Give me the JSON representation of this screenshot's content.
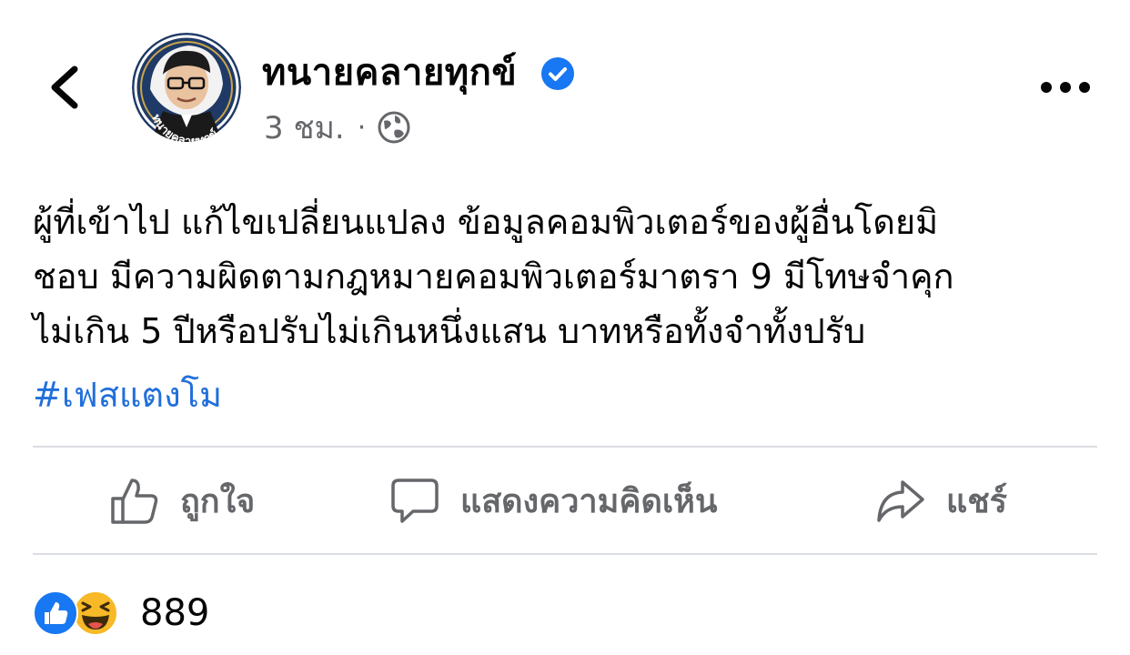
{
  "post": {
    "author": "ทนายคลายทุกข์",
    "avatar_text": "ทนายคลายทุกข์",
    "time": "3 ชม.",
    "separator": "·",
    "text_lines": [
      "ผู้ที่เข้าไป แก้ไขเปลี่ยนแปลง ข้อมูลคอมพิวเตอร์ของผู้อื่นโดยมิ",
      "ชอบ มีความผิดตามกฎหมายคอมพิวเตอร์มาตรา 9 มีโทษจำคุก",
      "ไม่เกิน 5 ปีหรือปรับไม่เกินหนึ่งแสน  บาทหรือทั้งจำทั้งปรับ"
    ],
    "hashtag": "#เฟสแตงโม"
  },
  "actions": {
    "like_label": "ถูกใจ",
    "comment_label": "แสดงความคิดเห็น",
    "share_label": "แชร์"
  },
  "reactions": {
    "icons": [
      "like-reaction-icon",
      "haha-reaction-icon"
    ],
    "count": "889"
  },
  "colors": {
    "link": "#216fdb",
    "muted": "#65676b",
    "verified": "#1877f2",
    "like": "#1877f2",
    "haha": "#f7b928"
  }
}
